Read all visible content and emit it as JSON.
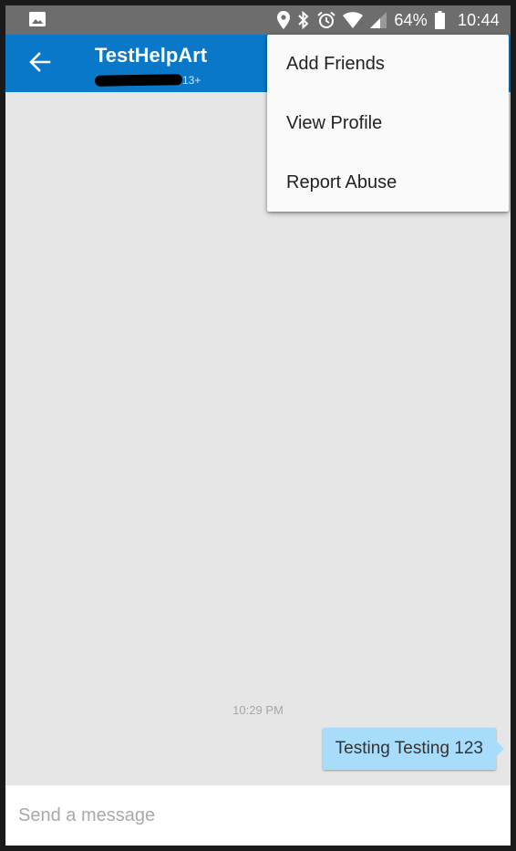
{
  "status_bar": {
    "icons": [
      "image-icon",
      "location-icon",
      "bluetooth-icon",
      "alarm-icon",
      "wifi-icon",
      "signal-icon",
      "battery-icon"
    ],
    "battery_percent": "64%",
    "time": "10:44"
  },
  "app_bar": {
    "back_icon": "arrow-left-icon",
    "title": "TestHelpArt",
    "age_badge": "13+",
    "color": "#0a78c8"
  },
  "menu": {
    "items": [
      {
        "label": "Add Friends"
      },
      {
        "label": "View Profile"
      },
      {
        "label": "Report Abuse"
      }
    ]
  },
  "chat": {
    "messages": [
      {
        "timestamp": "10:29 PM",
        "text": "Testing Testing 123",
        "from_me": true
      }
    ],
    "bubble_color": "#a8dcfb",
    "background": "#e6e6e6"
  },
  "composer": {
    "placeholder": "Send a message",
    "value": ""
  }
}
